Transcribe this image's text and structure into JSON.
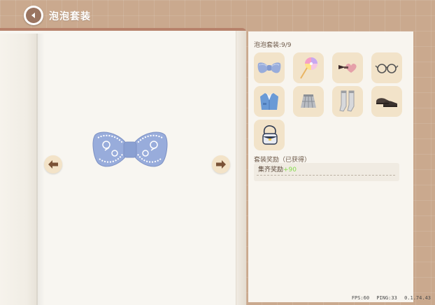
{
  "header": {
    "title": "泡泡套装"
  },
  "panel": {
    "set_progress": "泡泡套装:9/9",
    "items": [
      {
        "icon": "bow-icon"
      },
      {
        "icon": "lollipop-icon"
      },
      {
        "icon": "heart-hairclip-icon"
      },
      {
        "icon": "glasses-icon"
      },
      {
        "icon": "jacket-icon"
      },
      {
        "icon": "plaid-skirt-icon"
      },
      {
        "icon": "socks-icon"
      },
      {
        "icon": "shoes-icon"
      },
      {
        "icon": "bag-icon"
      }
    ],
    "reward_title": "套装奖励（已获得）",
    "reward_label": "集齐奖励",
    "reward_amount": "+90"
  },
  "hud": {
    "fps": "FPS:60",
    "ping": "PING:33",
    "version": "0.1.74.43"
  },
  "colors": {
    "background": "#caa98e",
    "book_border": "#b7826b",
    "item_bg": "#f2e3c9",
    "bow_blue": "#98acdb",
    "reward_green": "#86dc4e"
  }
}
